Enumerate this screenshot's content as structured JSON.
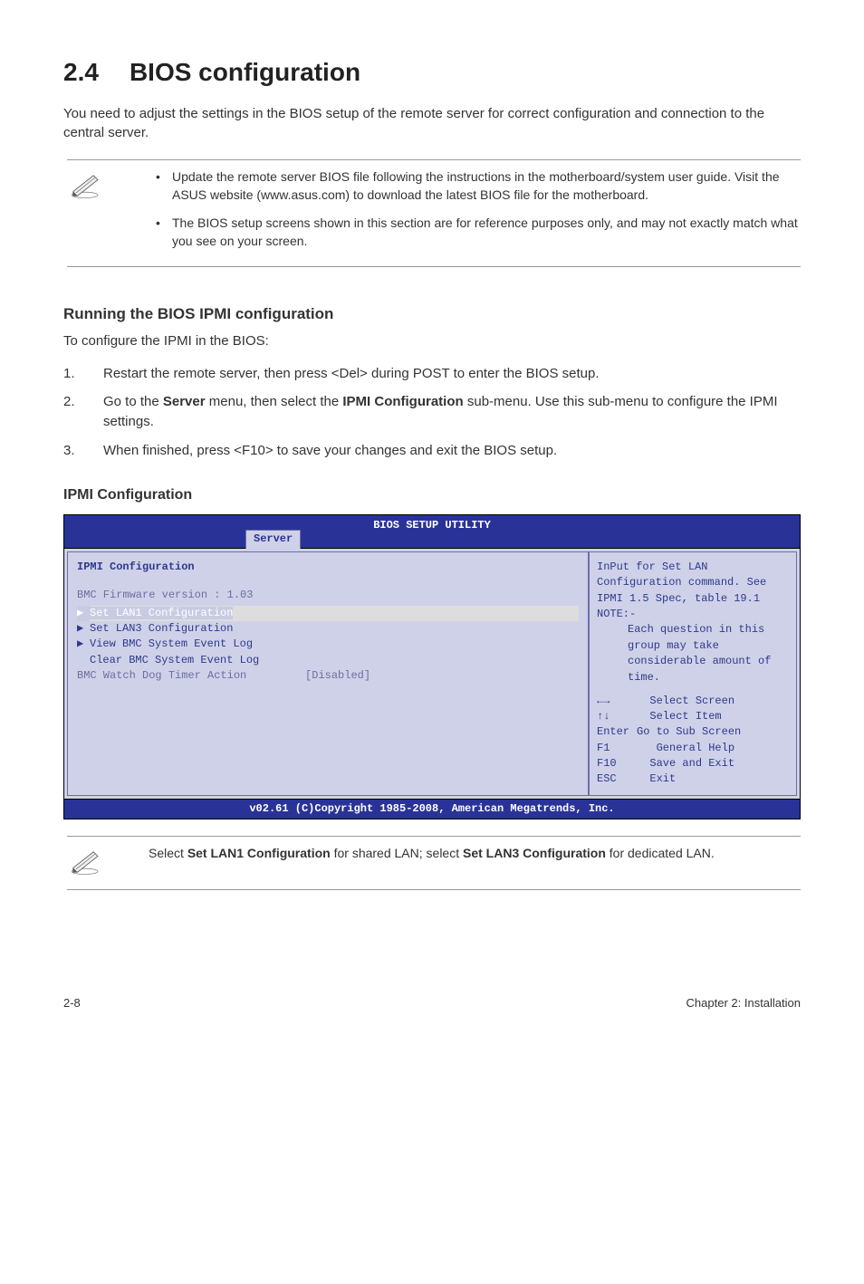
{
  "section": {
    "number": "2.4",
    "title": "BIOS configuration"
  },
  "intro": "You need to adjust the settings in the BIOS setup of the remote server for correct configuration and connection to the central server.",
  "notes_top": [
    "Update the remote server BIOS file following the instructions in the motherboard/system user guide. Visit the ASUS website (www.asus.com) to download the latest BIOS file for the motherboard.",
    "The BIOS setup screens shown in this section are for reference purposes only, and may not exactly match what you see on your screen."
  ],
  "sub": {
    "heading": "Running the BIOS IPMI configuration",
    "intro": "To configure the IPMI in the BIOS:",
    "steps": [
      "Restart the remote server, then press <Del> during POST to enter the BIOS setup.",
      "Go to the Server menu, then select the IPMI Configuration sub-menu. Use this sub-menu to configure the IPMI settings.",
      "When finished, press <F10> to save your changes and exit the BIOS setup."
    ]
  },
  "ipmi_title": "IPMI Configuration",
  "bios": {
    "top_title": "BIOS SETUP UTILITY",
    "tab": "Server",
    "left": {
      "title": "IPMI Configuration",
      "firmware": "BMC Firmware version : 1.03",
      "items": [
        {
          "label": "Set LAN1 Configuration",
          "selected": true
        },
        {
          "label": "Set LAN3 Configuration",
          "selected": false
        },
        {
          "label": "View BMC System Event Log",
          "selected": false
        }
      ],
      "clear": "Clear BMC System Event Log",
      "watch_label": "BMC Watch Dog Timer Action",
      "watch_value": "[Disabled]"
    },
    "right": {
      "help": "InPut for Set LAN Configuration command. See IPMI 1.5 Spec, table 19.1",
      "note_label": "NOTE:-",
      "note_body": "Each question in this group may take considerable amount of time.",
      "nav": {
        "select_screen": "Select Screen",
        "select_item": "Select Item",
        "enter_key": "Enter",
        "enter_txt": "Go to Sub Screen",
        "f1_key": "F1",
        "f1_txt": "General Help",
        "f10_key": "F10",
        "f10_txt": "Save and Exit",
        "esc_key": "ESC",
        "esc_txt": "Exit"
      }
    },
    "footer": "v02.61 (C)Copyright 1985-2008, American Megatrends, Inc."
  },
  "note_bottom_prefix": "Select ",
  "note_bottom_b1": "Set LAN1 Configuration",
  "note_bottom_mid": " for shared LAN; select ",
  "note_bottom_b2": "Set LAN3 Configuration",
  "note_bottom_suffix": " for dedicated LAN.",
  "footer": {
    "left": "2-8",
    "right": "Chapter 2: Installation"
  }
}
